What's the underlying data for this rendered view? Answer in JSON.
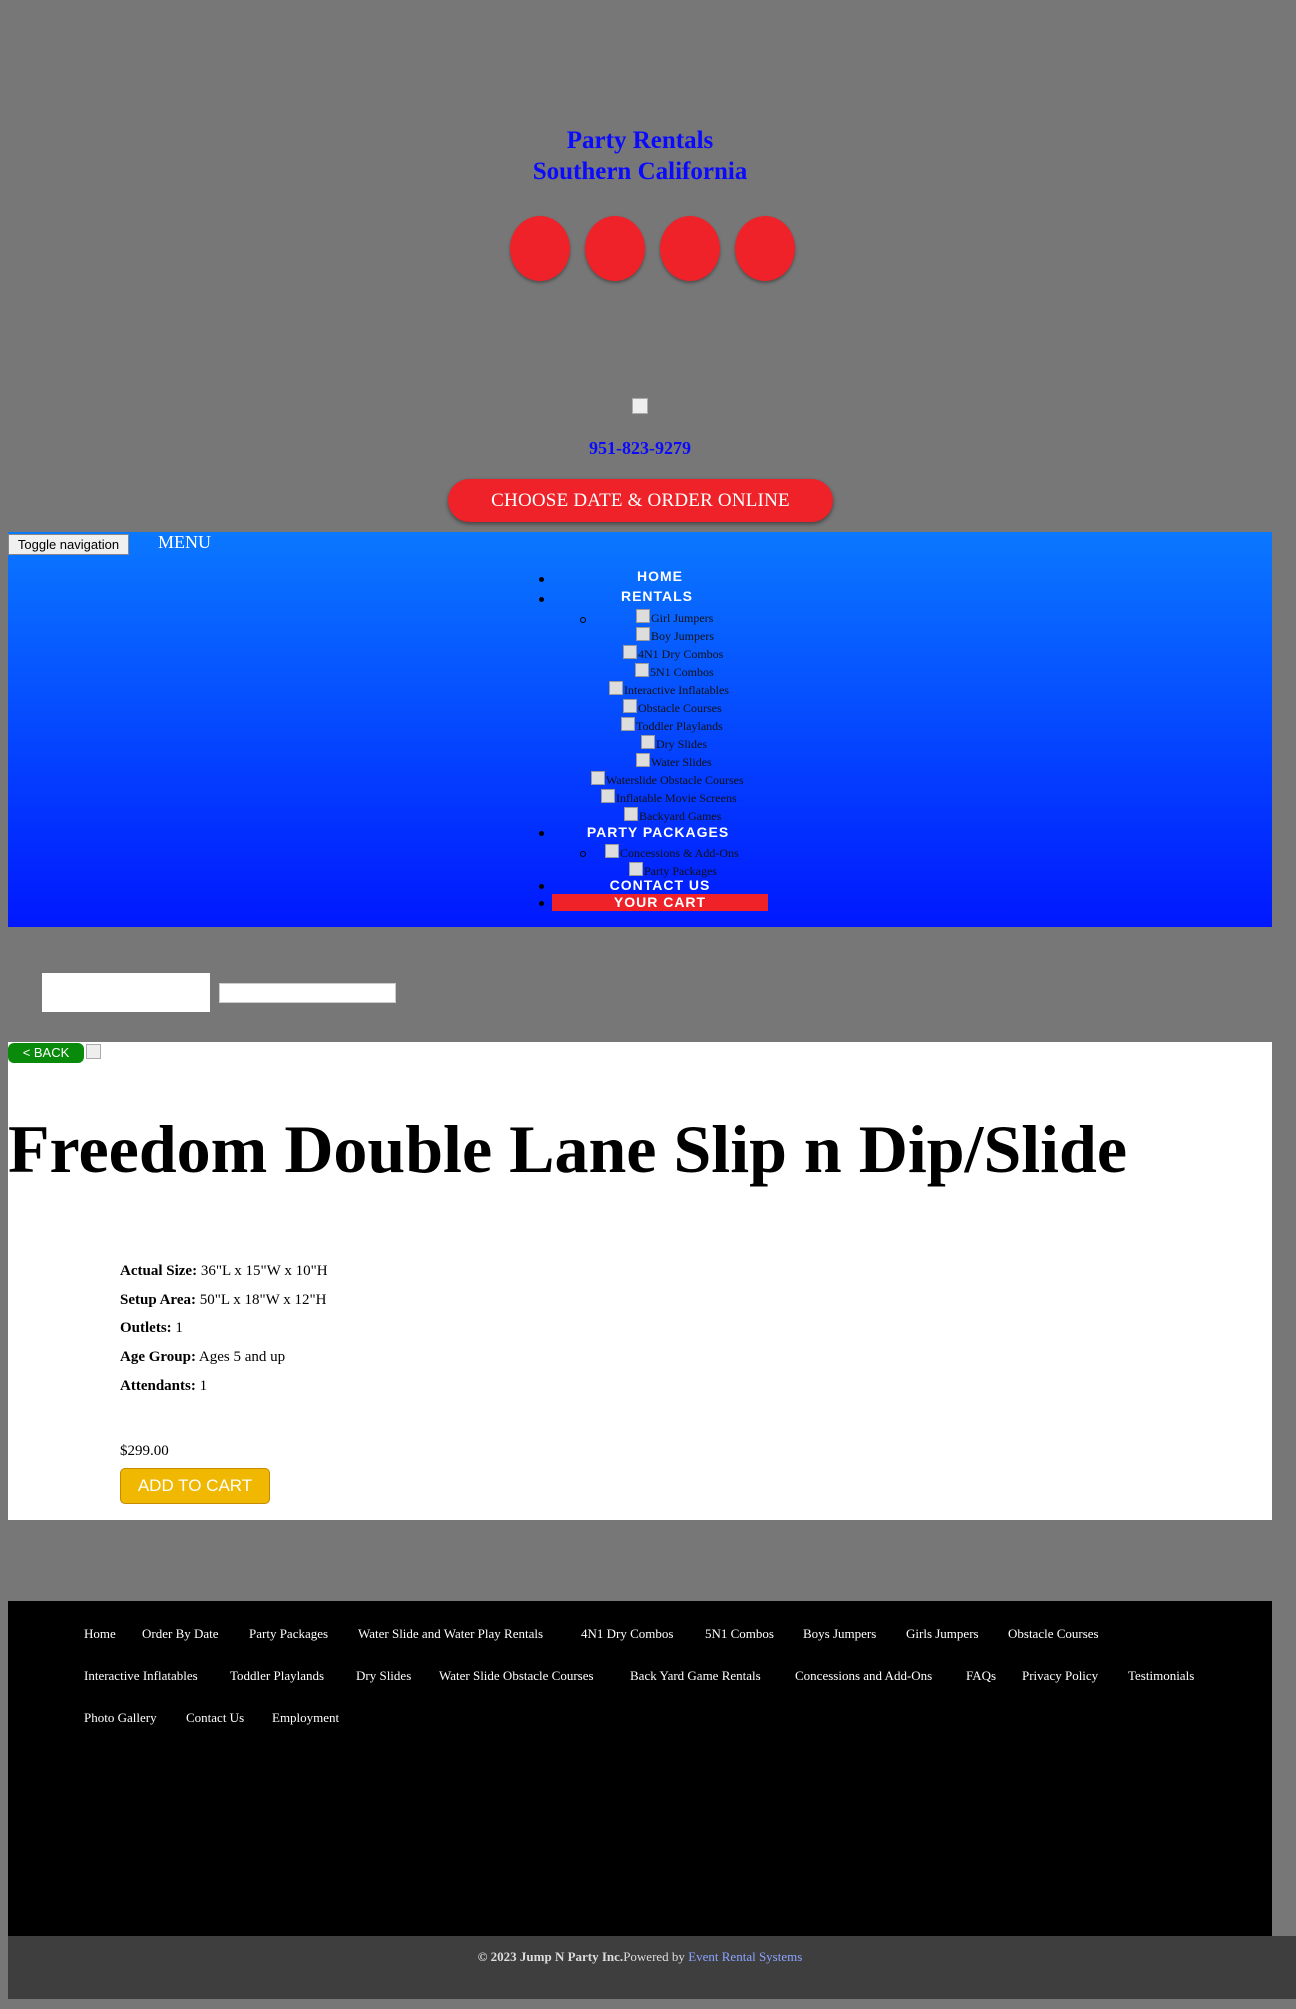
{
  "header": {
    "brand_line1": "Party Rentals",
    "brand_line2": "Southern California",
    "social_icons": [
      "social-icon-1",
      "social-icon-2",
      "social-icon-3",
      "social-icon-4"
    ],
    "phone": "951-823-9279",
    "order_button": "CHOOSE DATE & ORDER ONLINE"
  },
  "nav": {
    "toggle_label": "Toggle navigation",
    "menu_label": "MENU",
    "home": "HOME",
    "rentals": "RENTALS",
    "rentals_items": [
      "Girl Jumpers",
      "Boy Jumpers",
      "4N1 Dry Combos",
      "5N1 Combos",
      "Interactive Inflatables",
      "Obstacle Courses",
      "Toddler Playlands",
      "Dry Slides",
      "Water Slides",
      "Waterslide Obstacle Courses",
      "Inflatable Movie Screens",
      "Backyard Games"
    ],
    "party_packages": "PARTY PACKAGES",
    "party_items": [
      "Concessions & Add-Ons",
      "Party Packages"
    ],
    "contact": "CONTACT US",
    "cart": "YOUR CART"
  },
  "product": {
    "back_label": "< BACK",
    "title": "Freedom Double Lane Slip n Dip/Slide",
    "specs": [
      {
        "label": "Actual Size:",
        "value": " 36\"L x 15\"W x 10\"H"
      },
      {
        "label": "Setup Area:",
        "value": " 50\"L x 18\"W x 12\"H"
      },
      {
        "label": "Outlets:",
        "value": " 1"
      },
      {
        "label": "Age Group:",
        "value": " Ages 5 and up"
      },
      {
        "label": "Attendants:",
        "value": " 1"
      }
    ],
    "price": "$299.00",
    "add_to_cart": "ADD TO CART"
  },
  "footer": {
    "links": [
      "Home",
      "Order By Date",
      "Party Packages",
      "Water Slide and Water Play Rentals",
      "4N1 Dry Combos",
      "5N1 Combos",
      "Boys Jumpers",
      "Girls Jumpers",
      "Obstacle Courses",
      "Interactive Inflatables",
      "Toddler Playlands",
      "Dry Slides",
      "Water Slide Obstacle Courses",
      "Back Yard Game Rentals",
      "Concessions and Add-Ons",
      "FAQs",
      "Privacy Policy",
      "Testimonials",
      "Photo Gallery",
      "Contact Us",
      "Employment"
    ],
    "copyright": "© 2023 Jump N Party Inc.",
    "powered_by": "Powered by ",
    "powered_link": "Event Rental Systems"
  },
  "colors": {
    "page_bg": "#777777",
    "brand_blue": "#0a0aff",
    "accent_red": "#ee2228",
    "back_green": "#0a8a0a",
    "cart_gold": "#f0b800"
  }
}
